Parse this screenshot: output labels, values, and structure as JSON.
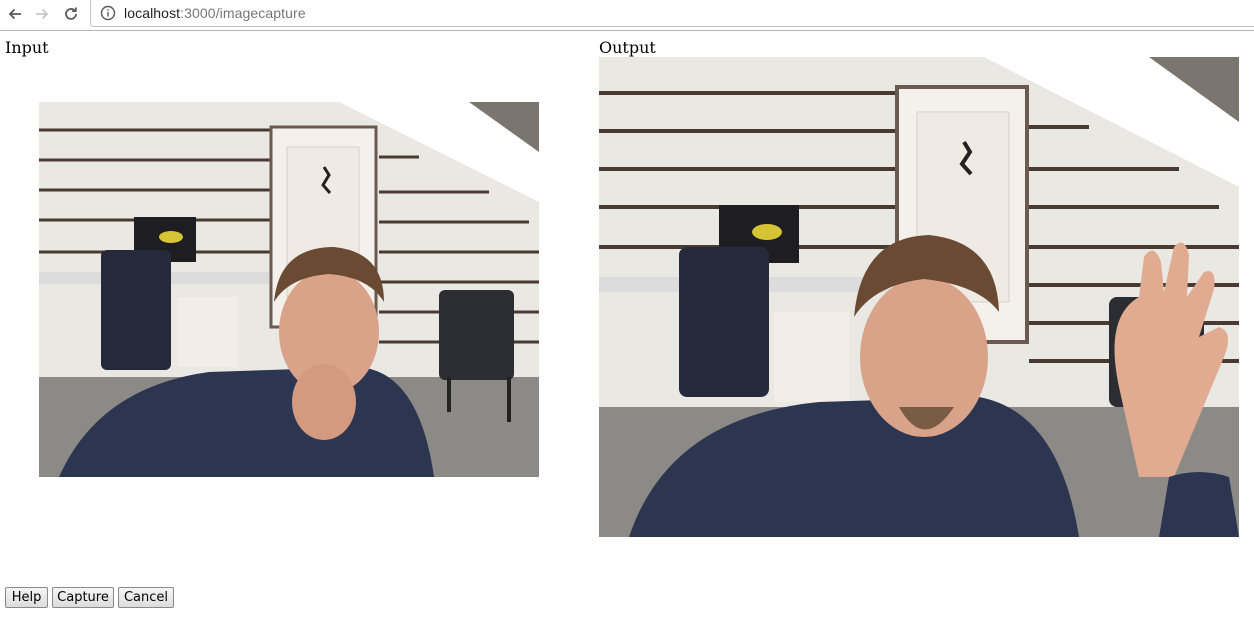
{
  "browser": {
    "url_host": "localhost",
    "url_rest": ":3000/imagecapture"
  },
  "icons": {
    "back": "arrow-left-icon",
    "forward": "arrow-right-icon",
    "reload": "reload-icon",
    "info": "info-icon"
  },
  "page": {
    "input_label": "Input",
    "output_label": "Output"
  },
  "buttons": {
    "help": "Help",
    "capture": "Capture",
    "cancel": "Cancel"
  },
  "colors": {
    "wall": "#efefec",
    "wall_lines": "#4a3a32",
    "jacket": "#2c3650",
    "skin": "#d9a38a",
    "hair": "#6b4a33"
  }
}
